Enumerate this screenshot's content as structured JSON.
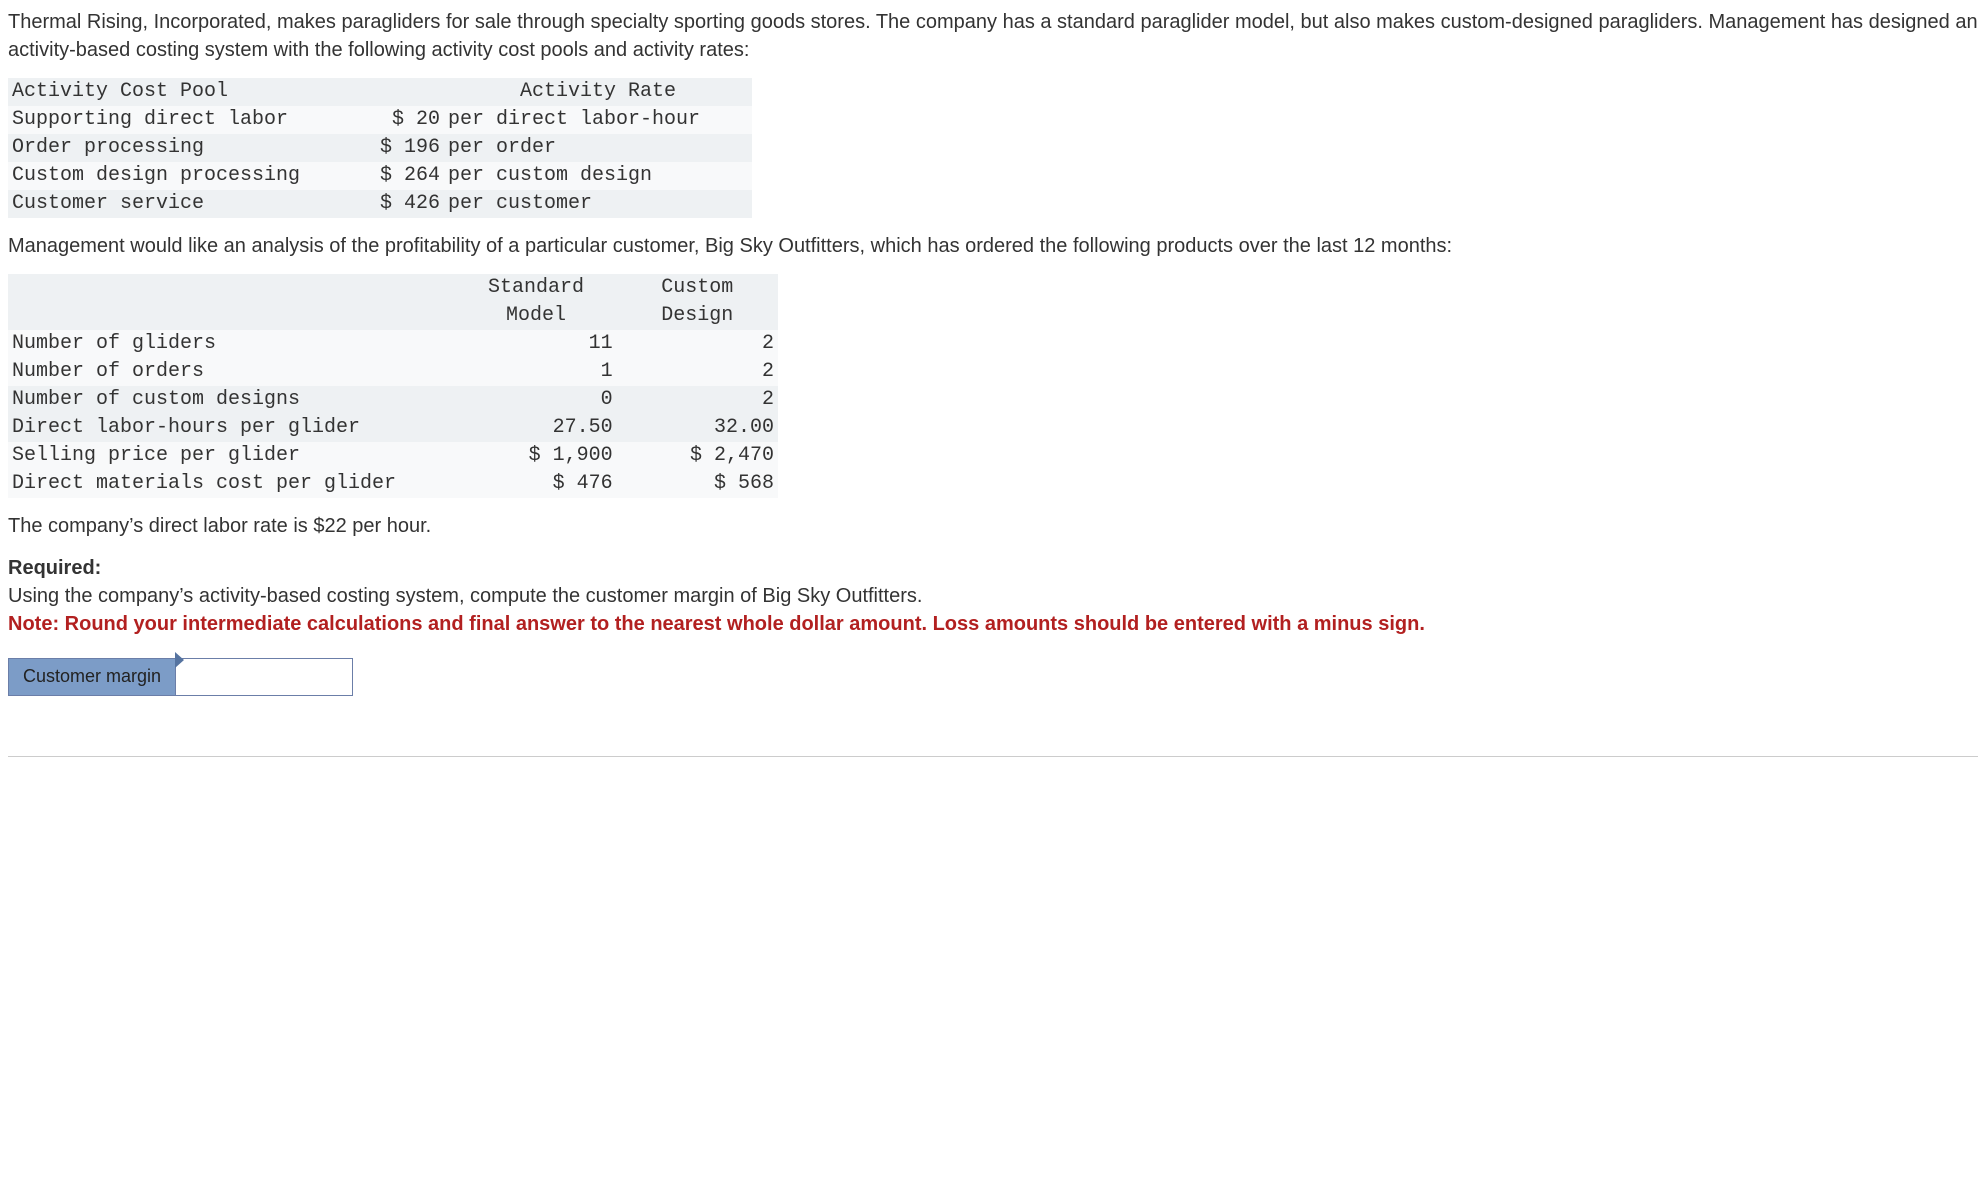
{
  "intro": "Thermal Rising, Incorporated, makes paragliders for sale through specialty sporting goods stores. The company has a standard paraglider model, but also makes custom-designed paragliders. Management has designed an activity-based costing system with the following activity cost pools and activity rates:",
  "table1": {
    "headers": {
      "pool": "Activity Cost Pool",
      "rate": "Activity Rate"
    },
    "rows": [
      {
        "pool": "Supporting direct labor",
        "amount": "$ 20",
        "unit": "per direct labor-hour"
      },
      {
        "pool": "Order processing",
        "amount": "$ 196",
        "unit": "per order"
      },
      {
        "pool": "Custom design processing",
        "amount": "$ 264",
        "unit": "per custom design"
      },
      {
        "pool": "Customer service",
        "amount": "$ 426",
        "unit": "per customer"
      }
    ]
  },
  "mid": "Management would like an analysis of the profitability of a particular customer, Big Sky Outfitters, which has ordered the following products over the last 12 months:",
  "table2": {
    "headers": {
      "std_l1": "Standard",
      "std_l2": "Model",
      "cust_l1": "Custom",
      "cust_l2": "Design"
    },
    "rows": [
      {
        "label": "Number of gliders",
        "std": "11",
        "cust": "2"
      },
      {
        "label": "Number of orders",
        "std": "1",
        "cust": "2"
      },
      {
        "label": "Number of custom designs",
        "std": "0",
        "cust": "2"
      },
      {
        "label": "Direct labor-hours per glider",
        "std": "27.50",
        "cust": "32.00"
      },
      {
        "label": "Selling price per glider",
        "std": "$ 1,900",
        "cust": "$ 2,470"
      },
      {
        "label": "Direct materials cost per glider",
        "std": "$ 476",
        "cust": "$ 568"
      }
    ]
  },
  "rate_line": "The company’s direct labor rate is $22 per hour.",
  "required": {
    "heading": "Required:",
    "text": "Using the company’s activity-based costing system, compute the customer margin of Big Sky Outfitters.",
    "note": "Note: Round your intermediate calculations and final answer to the nearest whole dollar amount. Loss amounts should be entered with a minus sign."
  },
  "answer": {
    "label": "Customer margin",
    "value": ""
  }
}
